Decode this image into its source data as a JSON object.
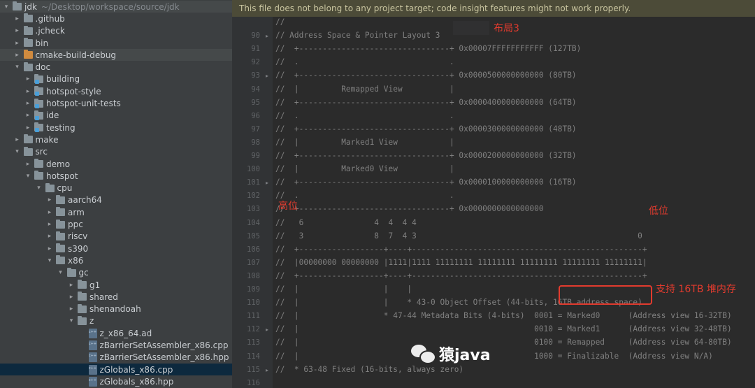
{
  "tree": {
    "rows": [
      {
        "label": "jdk",
        "path": "~/Desktop/workspace/source/jdk",
        "arrow": "▾",
        "indent": 0,
        "icon": "folder",
        "highlight": true
      },
      {
        "label": ".github",
        "arrow": "▸",
        "indent": 1,
        "icon": "folder"
      },
      {
        "label": ".jcheck",
        "arrow": "▸",
        "indent": 1,
        "icon": "folder"
      },
      {
        "label": "bin",
        "arrow": "▸",
        "indent": 1,
        "icon": "folder"
      },
      {
        "label": "cmake-build-debug",
        "arrow": "▸",
        "indent": 1,
        "icon": "folder-orange",
        "highlight": true
      },
      {
        "label": "doc",
        "arrow": "▾",
        "indent": 1,
        "icon": "folder"
      },
      {
        "label": "building",
        "arrow": "▸",
        "indent": 2,
        "icon": "modfolder"
      },
      {
        "label": "hotspot-style",
        "arrow": "▸",
        "indent": 2,
        "icon": "modfolder"
      },
      {
        "label": "hotspot-unit-tests",
        "arrow": "▸",
        "indent": 2,
        "icon": "modfolder"
      },
      {
        "label": "ide",
        "arrow": "▸",
        "indent": 2,
        "icon": "modfolder"
      },
      {
        "label": "testing",
        "arrow": "▸",
        "indent": 2,
        "icon": "modfolder"
      },
      {
        "label": "make",
        "arrow": "▸",
        "indent": 1,
        "icon": "folder"
      },
      {
        "label": "src",
        "arrow": "▾",
        "indent": 1,
        "icon": "folder"
      },
      {
        "label": "demo",
        "arrow": "▸",
        "indent": 2,
        "icon": "folder"
      },
      {
        "label": "hotspot",
        "arrow": "▾",
        "indent": 2,
        "icon": "folder"
      },
      {
        "label": "cpu",
        "arrow": "▾",
        "indent": 3,
        "icon": "folder"
      },
      {
        "label": "aarch64",
        "arrow": "▸",
        "indent": 4,
        "icon": "folder"
      },
      {
        "label": "arm",
        "arrow": "▸",
        "indent": 4,
        "icon": "folder"
      },
      {
        "label": "ppc",
        "arrow": "▸",
        "indent": 4,
        "icon": "folder"
      },
      {
        "label": "riscv",
        "arrow": "▸",
        "indent": 4,
        "icon": "folder"
      },
      {
        "label": "s390",
        "arrow": "▸",
        "indent": 4,
        "icon": "folder"
      },
      {
        "label": "x86",
        "arrow": "▾",
        "indent": 4,
        "icon": "folder"
      },
      {
        "label": "gc",
        "arrow": "▾",
        "indent": 5,
        "icon": "folder"
      },
      {
        "label": "g1",
        "arrow": "▸",
        "indent": 6,
        "icon": "folder"
      },
      {
        "label": "shared",
        "arrow": "▸",
        "indent": 6,
        "icon": "folder"
      },
      {
        "label": "shenandoah",
        "arrow": "▸",
        "indent": 6,
        "icon": "folder"
      },
      {
        "label": "z",
        "arrow": "▾",
        "indent": 6,
        "icon": "folder"
      },
      {
        "label": "z_x86_64.ad",
        "arrow": "",
        "indent": 7,
        "icon": "file"
      },
      {
        "label": "zBarrierSetAssembler_x86.cpp",
        "arrow": "",
        "indent": 7,
        "icon": "file"
      },
      {
        "label": "zBarrierSetAssembler_x86.hpp",
        "arrow": "",
        "indent": 7,
        "icon": "file"
      },
      {
        "label": "zGlobals_x86.cpp",
        "arrow": "",
        "indent": 7,
        "icon": "file",
        "selected": true
      },
      {
        "label": "zGlobals_x86.hpp",
        "arrow": "",
        "indent": 7,
        "icon": "file"
      }
    ]
  },
  "editor": {
    "banner": "This file does not belong to any project target; code insight features might not work properly.",
    "lines": [
      {
        "num": "",
        "text": "//"
      },
      {
        "num": "90",
        "text": "// Address Space & Pointer Layout 3"
      },
      {
        "num": "91",
        "text": "//  +--------------------------------+ 0x00007FFFFFFFFFFF (127TB)"
      },
      {
        "num": "92",
        "text": "//  .                                ."
      },
      {
        "num": "93",
        "text": "//  +--------------------------------+ 0x0000500000000000 (80TB)"
      },
      {
        "num": "94",
        "text": "//  |         Remapped View          |"
      },
      {
        "num": "95",
        "text": "//  +--------------------------------+ 0x0000400000000000 (64TB)"
      },
      {
        "num": "96",
        "text": "//  .                                ."
      },
      {
        "num": "97",
        "text": "//  +--------------------------------+ 0x0000300000000000 (48TB)"
      },
      {
        "num": "98",
        "text": "//  |         Marked1 View           |"
      },
      {
        "num": "99",
        "text": "//  +--------------------------------+ 0x0000200000000000 (32TB)"
      },
      {
        "num": "100",
        "text": "//  |         Marked0 View           |"
      },
      {
        "num": "101",
        "text": "//  +--------------------------------+ 0x0000100000000000 (16TB)"
      },
      {
        "num": "102",
        "text": "//  .                                ."
      },
      {
        "num": "103",
        "text": "//  +--------------------------------+ 0x0000000000000000"
      },
      {
        "num": "104",
        "text": "//   6               4  4  4 4"
      },
      {
        "num": "105",
        "text": "//   3               8  7  4 3                                               0"
      },
      {
        "num": "106",
        "text": "//  +------------------+----+-------------------------------------------------+"
      },
      {
        "num": "107",
        "text": "//  |00000000 00000000 |1111|1111 11111111 11111111 11111111 11111111 11111111|"
      },
      {
        "num": "108",
        "text": "//  +------------------+----+-------------------------------------------------+"
      },
      {
        "num": "109",
        "text": "//  |                  |    |"
      },
      {
        "num": "110",
        "text": "//  |                  |    * 43-0 Object Offset (44-bits, 16TB address space)"
      },
      {
        "num": "111",
        "text": "//  |                  * 47-44 Metadata Bits (4-bits)  0001 = Marked0      (Address view 16-32TB)"
      },
      {
        "num": "112",
        "text": "//  |                                                  0010 = Marked1      (Address view 32-48TB)"
      },
      {
        "num": "113",
        "text": "//  |                                                  0100 = Remapped     (Address view 64-80TB)"
      },
      {
        "num": "114",
        "text": "//  |                                                  1000 = Finalizable  (Address view N/A)"
      },
      {
        "num": "115",
        "text": "//  * 63-48 Fixed (16-bits, always zero)"
      },
      {
        "num": "116",
        "text": ""
      }
    ]
  },
  "annotations": {
    "layout": "布局3",
    "high": "高位",
    "low": "低位",
    "heap": "支持 16TB 堆内存"
  },
  "watermark": {
    "icon": "wechat-icon",
    "text": "猿java"
  }
}
